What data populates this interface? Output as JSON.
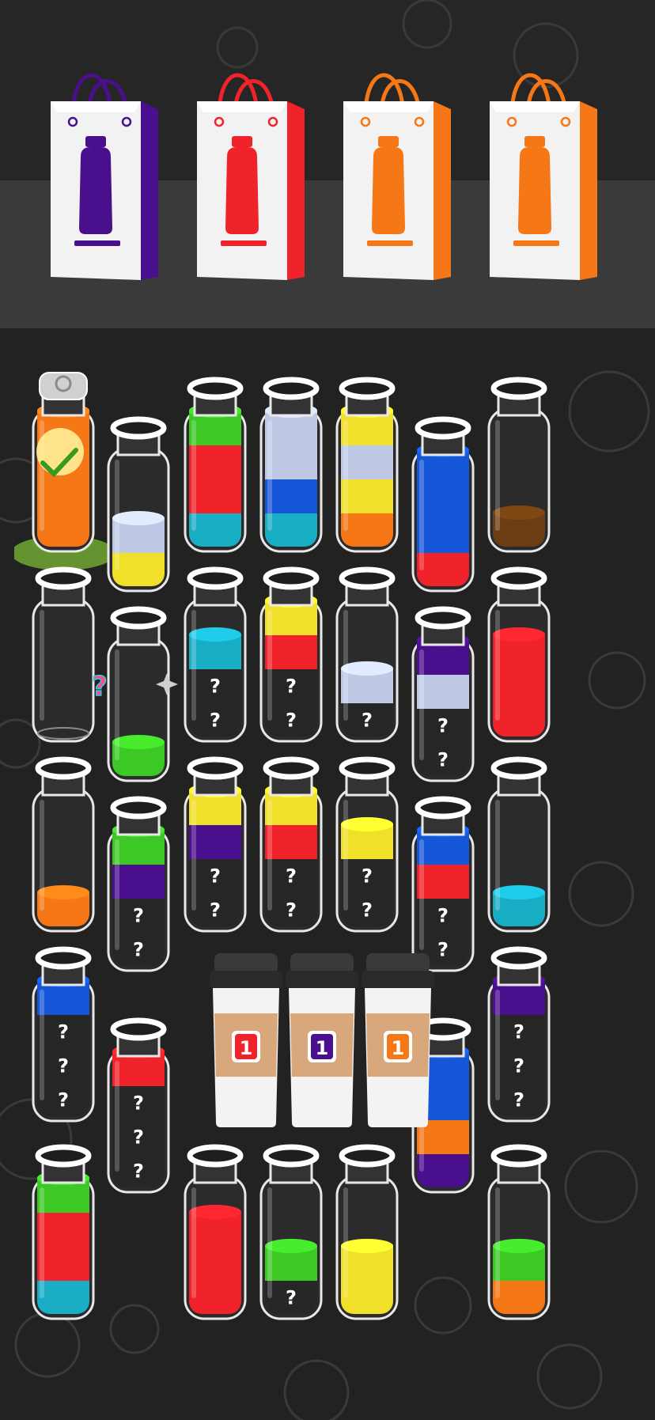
{
  "colors": {
    "purple": "#4a0f8c",
    "red": "#f0222a",
    "orange": "#f57716",
    "green": "#3cc926",
    "cyan": "#1aaec6",
    "blue": "#1656d8",
    "yellow": "#f0e02a",
    "lavender": "#bfc9e6",
    "brown": "#6b3d12",
    "unknown": "#262626",
    "background": "#222222"
  },
  "bags": [
    {
      "color": "purple",
      "icon": "bottle-icon"
    },
    {
      "color": "red",
      "icon": "bottle-icon"
    },
    {
      "color": "orange",
      "icon": "bottle-icon"
    },
    {
      "color": "orange",
      "icon": "bottle-icon"
    }
  ],
  "unknown_mark": "?",
  "bottles": [
    {
      "id": "r1c1",
      "completed": true,
      "capped": true,
      "layers": [
        "orange",
        "orange",
        "orange",
        "orange"
      ]
    },
    {
      "id": "r1c2",
      "layers": [
        "yellow",
        "lavender"
      ]
    },
    {
      "id": "r1c3",
      "layers": [
        "cyan",
        "red",
        "red",
        "green"
      ]
    },
    {
      "id": "r1c4",
      "layers": [
        "cyan",
        "blue",
        "lavender",
        "lavender"
      ]
    },
    {
      "id": "r1c5",
      "layers": [
        "orange",
        "yellow",
        "lavender",
        "yellow"
      ]
    },
    {
      "id": "r1c6",
      "layers": [
        "red",
        "blue",
        "blue",
        "blue"
      ]
    },
    {
      "id": "r1c7",
      "layers": [
        "brown"
      ]
    },
    {
      "id": "r2c1",
      "layers": [],
      "hint": "??"
    },
    {
      "id": "r2c2",
      "layers": [
        "green"
      ],
      "sparkle": true
    },
    {
      "id": "r2c3",
      "layers": [
        "unknown",
        "unknown",
        "cyan"
      ]
    },
    {
      "id": "r2c4",
      "layers": [
        "unknown",
        "unknown",
        "red",
        "yellow"
      ]
    },
    {
      "id": "r2c5",
      "layers": [
        "unknown",
        "lavender"
      ]
    },
    {
      "id": "r2c6",
      "layers": [
        "unknown",
        "unknown",
        "lavender",
        "purple"
      ]
    },
    {
      "id": "r2c7",
      "layers": [
        "red",
        "red",
        "red"
      ]
    },
    {
      "id": "r3c1",
      "layers": [
        "orange"
      ]
    },
    {
      "id": "r3c2",
      "layers": [
        "unknown",
        "unknown",
        "purple",
        "green"
      ]
    },
    {
      "id": "r3c3",
      "layers": [
        "unknown",
        "unknown",
        "purple",
        "yellow"
      ]
    },
    {
      "id": "r3c4",
      "layers": [
        "unknown",
        "unknown",
        "red",
        "yellow"
      ]
    },
    {
      "id": "r3c5",
      "layers": [
        "unknown",
        "unknown",
        "yellow"
      ]
    },
    {
      "id": "r3c6",
      "layers": [
        "unknown",
        "unknown",
        "red",
        "blue"
      ]
    },
    {
      "id": "r3c7",
      "layers": [
        "cyan"
      ]
    },
    {
      "id": "r4c1",
      "layers": [
        "unknown",
        "unknown",
        "unknown",
        "blue"
      ]
    },
    {
      "id": "r4c2",
      "layers": [
        "unknown",
        "unknown",
        "unknown",
        "red"
      ]
    },
    {
      "id": "r4c6",
      "layers": [
        "purple",
        "orange",
        "blue",
        "blue"
      ]
    },
    {
      "id": "r4c7",
      "layers": [
        "unknown",
        "unknown",
        "unknown",
        "purple"
      ]
    },
    {
      "id": "r5c1",
      "layers": [
        "cyan",
        "red",
        "red",
        "green"
      ]
    },
    {
      "id": "r5c3",
      "layers": [
        "red",
        "red",
        "red"
      ]
    },
    {
      "id": "r5c4",
      "layers": [
        "unknown",
        "green"
      ]
    },
    {
      "id": "r5c5",
      "layers": [
        "yellow",
        "yellow"
      ]
    },
    {
      "id": "r5c7",
      "layers": [
        "orange",
        "green"
      ]
    }
  ],
  "cups": [
    {
      "id": "cup-1",
      "label": "1",
      "color": "red"
    },
    {
      "id": "cup-2",
      "label": "1",
      "color": "purple"
    },
    {
      "id": "cup-3",
      "label": "1",
      "color": "orange"
    }
  ]
}
